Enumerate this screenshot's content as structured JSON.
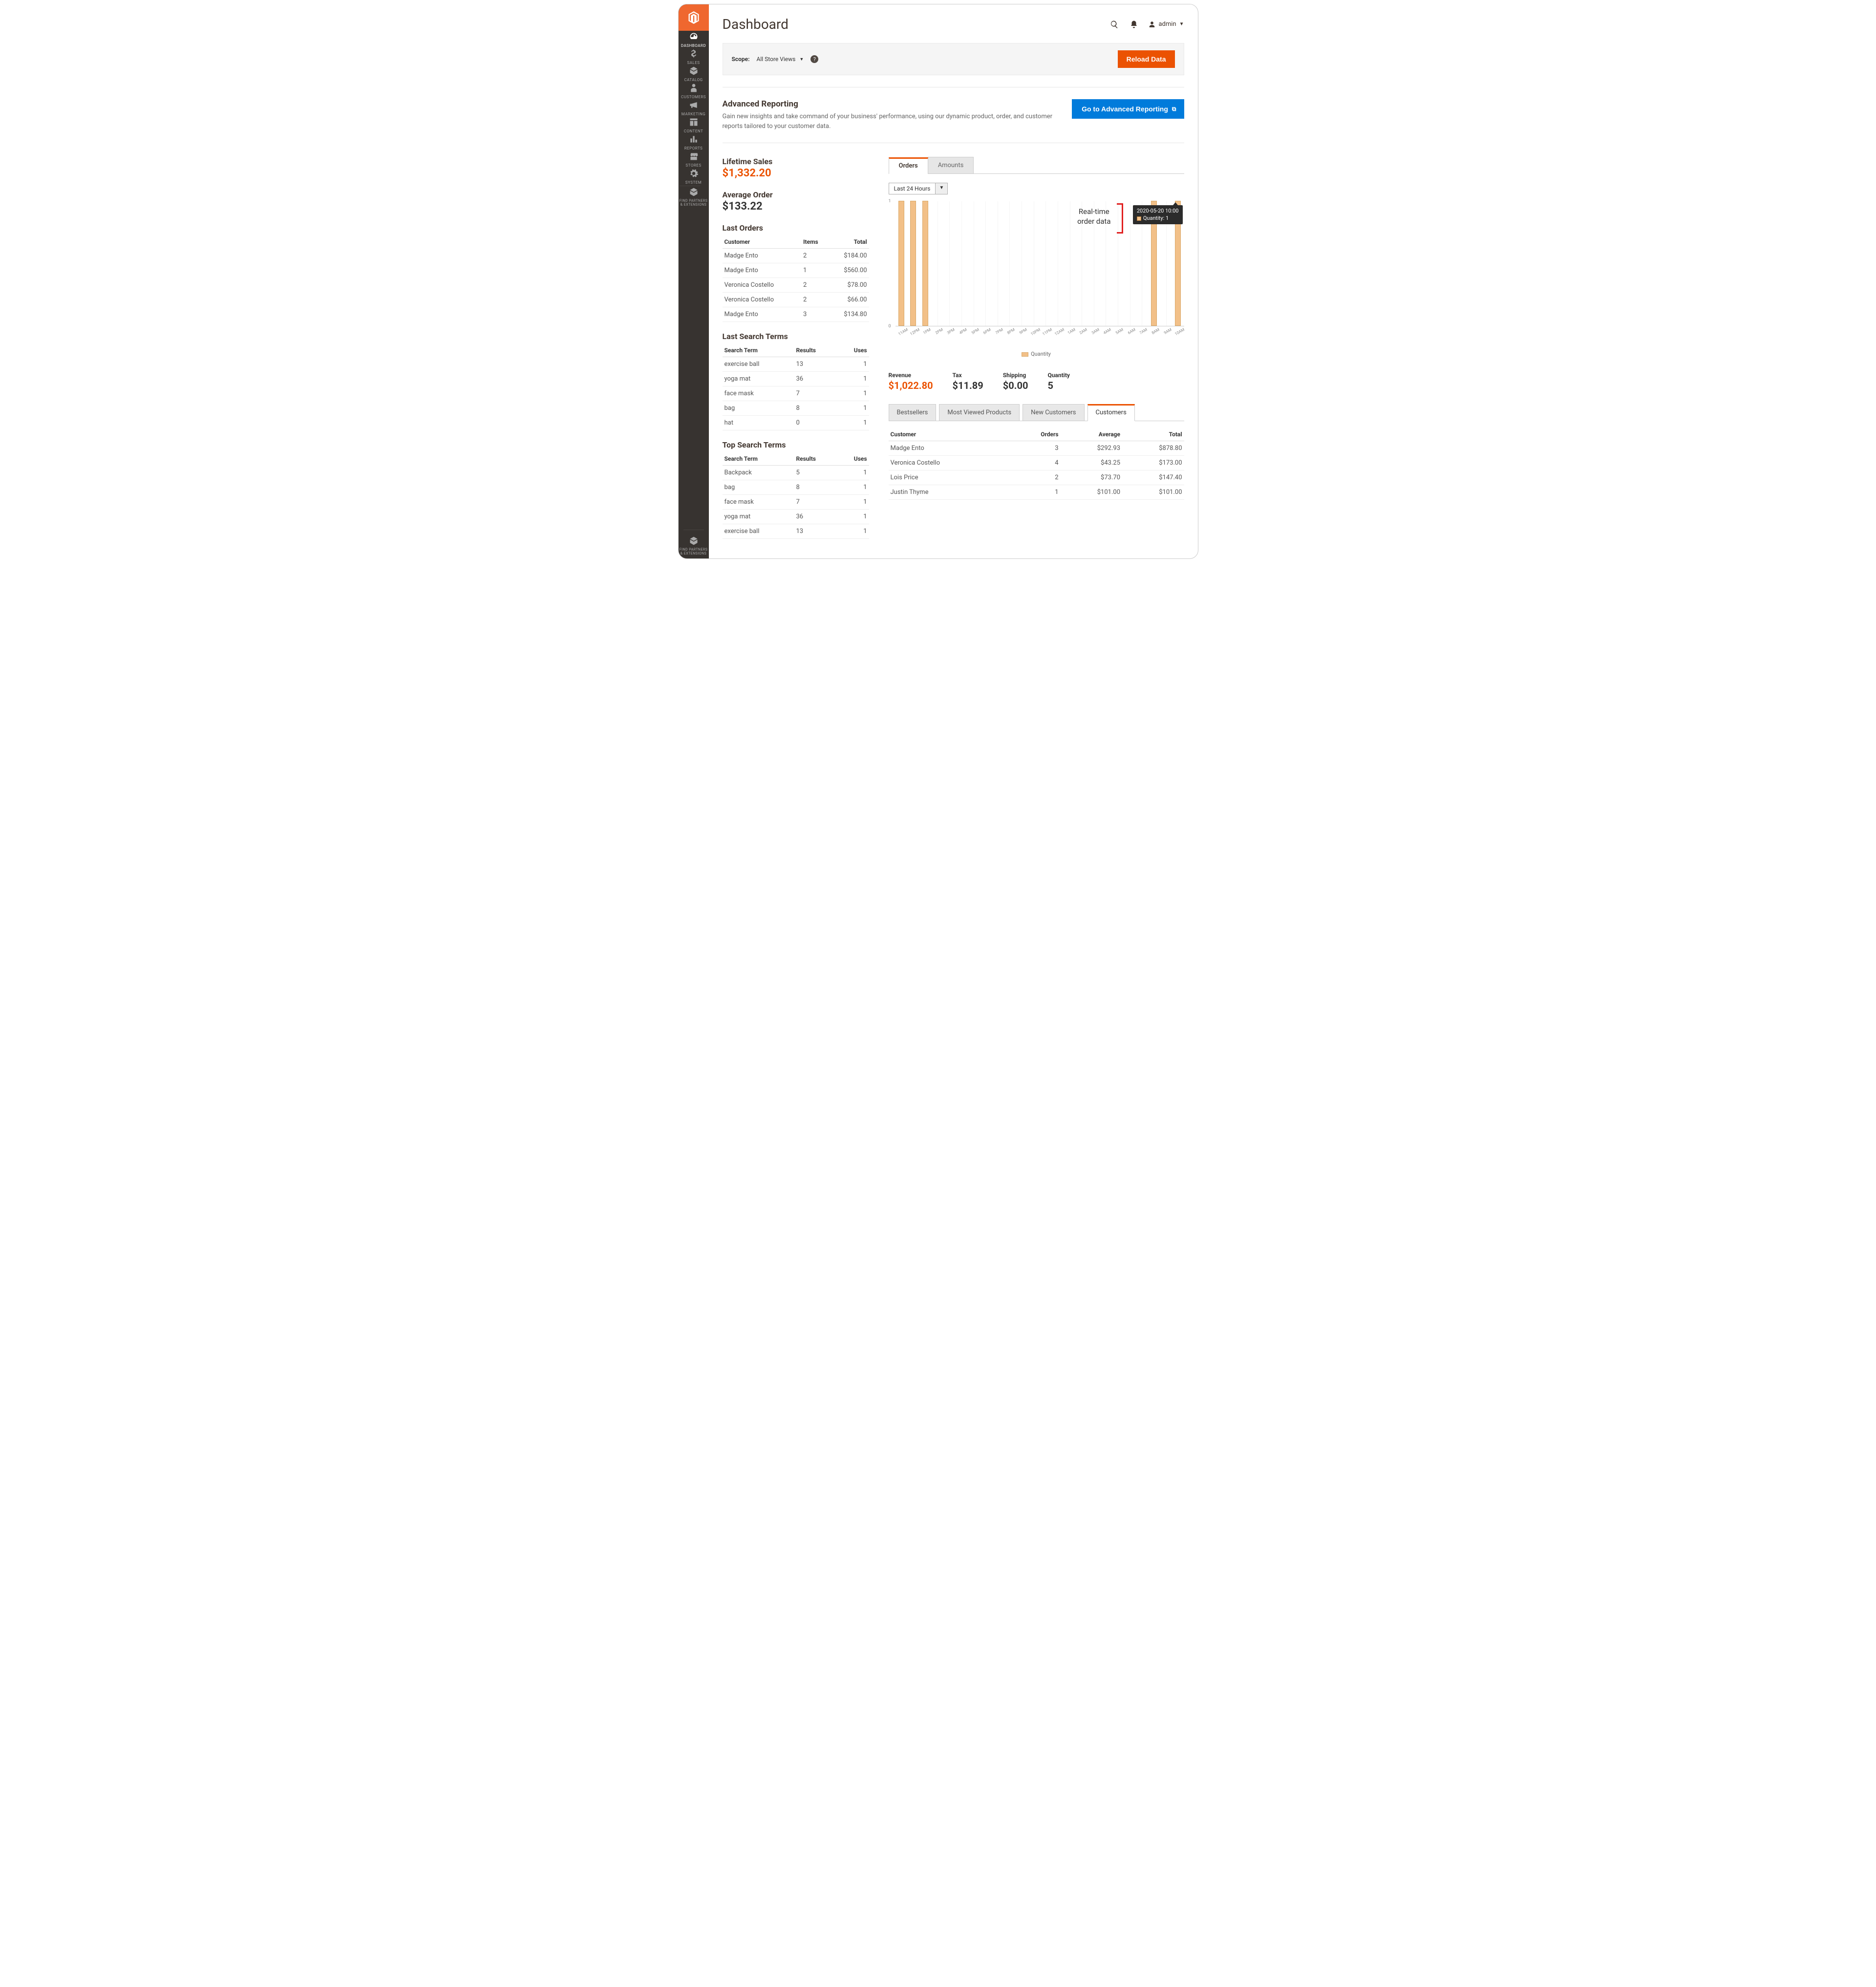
{
  "page_title": "Dashboard",
  "admin_user": "admin",
  "sidebar": {
    "items": [
      {
        "label": "DASHBOARD",
        "icon": "gauge",
        "active": true
      },
      {
        "label": "SALES",
        "icon": "dollar"
      },
      {
        "label": "CATALOG",
        "icon": "cube"
      },
      {
        "label": "CUSTOMERS",
        "icon": "person"
      },
      {
        "label": "MARKETING",
        "icon": "megaphone"
      },
      {
        "label": "CONTENT",
        "icon": "layout"
      },
      {
        "label": "REPORTS",
        "icon": "barchart"
      },
      {
        "label": "STORES",
        "icon": "storefront"
      },
      {
        "label": "SYSTEM",
        "icon": "gear"
      },
      {
        "label": "FIND PARTNERS\n& EXTENSIONS",
        "icon": "cube"
      }
    ],
    "bottom": {
      "label": "FIND PARTNERS\n& EXTENSIONS",
      "icon": "cube"
    }
  },
  "scope": {
    "label": "Scope:",
    "value": "All Store Views",
    "reload_btn": "Reload Data"
  },
  "adv_reporting": {
    "heading": "Advanced Reporting",
    "desc": "Gain new insights and take command of your business' performance, using our dynamic product, order, and customer reports tailored to your customer data.",
    "button": "Go to Advanced Reporting"
  },
  "lifetime_sales": {
    "label": "Lifetime Sales",
    "value": "$1,332.20"
  },
  "average_order": {
    "label": "Average Order",
    "value": "$133.22"
  },
  "last_orders": {
    "heading": "Last Orders",
    "headers": [
      "Customer",
      "Items",
      "Total"
    ],
    "rows": [
      {
        "c": "Madge Ento",
        "i": "2",
        "t": "$184.00"
      },
      {
        "c": "Madge Ento",
        "i": "1",
        "t": "$560.00"
      },
      {
        "c": "Veronica Costello",
        "i": "2",
        "t": "$78.00"
      },
      {
        "c": "Veronica Costello",
        "i": "2",
        "t": "$66.00"
      },
      {
        "c": "Madge Ento",
        "i": "3",
        "t": "$134.80"
      }
    ]
  },
  "last_search": {
    "heading": "Last Search Terms",
    "headers": [
      "Search Term",
      "Results",
      "Uses"
    ],
    "rows": [
      {
        "t": "exercise ball",
        "r": "13",
        "u": "1"
      },
      {
        "t": "yoga mat",
        "r": "36",
        "u": "1"
      },
      {
        "t": "face mask",
        "r": "7",
        "u": "1"
      },
      {
        "t": "bag",
        "r": "8",
        "u": "1"
      },
      {
        "t": "hat",
        "r": "0",
        "u": "1"
      }
    ]
  },
  "top_search": {
    "heading": "Top Search Terms",
    "headers": [
      "Search Term",
      "Results",
      "Uses"
    ],
    "rows": [
      {
        "t": "Backpack",
        "r": "5",
        "u": "1"
      },
      {
        "t": "bag",
        "r": "8",
        "u": "1"
      },
      {
        "t": "face mask",
        "r": "7",
        "u": "1"
      },
      {
        "t": "yoga mat",
        "r": "36",
        "u": "1"
      },
      {
        "t": "exercise ball",
        "r": "13",
        "u": "1"
      }
    ]
  },
  "chart_tabs": {
    "orders": "Orders",
    "amounts": "Amounts"
  },
  "period": "Last 24 Hours",
  "chart_data": {
    "type": "bar",
    "title": "",
    "xlabel": "",
    "ylabel": "",
    "ylim": [
      0,
      1
    ],
    "categories": [
      "11AM",
      "12PM",
      "1PM",
      "2PM",
      "3PM",
      "4PM",
      "5PM",
      "6PM",
      "7PM",
      "8PM",
      "9PM",
      "10PM",
      "11PM",
      "12AM",
      "1AM",
      "2AM",
      "3AM",
      "4AM",
      "5AM",
      "6AM",
      "7AM",
      "8AM",
      "9AM",
      "10AM"
    ],
    "values": [
      1,
      1,
      1,
      0,
      0,
      0,
      0,
      0,
      0,
      0,
      0,
      0,
      0,
      0,
      0,
      0,
      0,
      0,
      0,
      0,
      0,
      1,
      0,
      1
    ],
    "series_name": "Quantity"
  },
  "chart_tooltip": {
    "ts": "2020-05-20 10:00",
    "label": "Quantity: 1"
  },
  "annotation_text": "Real-time\norder data",
  "summary": [
    {
      "label": "Revenue",
      "value": "$1,022.80",
      "accent": true
    },
    {
      "label": "Tax",
      "value": "$11.89"
    },
    {
      "label": "Shipping",
      "value": "$0.00"
    },
    {
      "label": "Quantity",
      "value": "5"
    }
  ],
  "lower_tabs": [
    "Bestsellers",
    "Most Viewed Products",
    "New Customers",
    "Customers"
  ],
  "lower_active_idx": 3,
  "customers_table": {
    "headers": [
      "Customer",
      "Orders",
      "Average",
      "Total"
    ],
    "rows": [
      {
        "c": "Madge Ento",
        "o": "3",
        "a": "$292.93",
        "t": "$878.80"
      },
      {
        "c": "Veronica Costello",
        "o": "4",
        "a": "$43.25",
        "t": "$173.00"
      },
      {
        "c": "Lois Price",
        "o": "2",
        "a": "$73.70",
        "t": "$147.40"
      },
      {
        "c": "Justin Thyme",
        "o": "1",
        "a": "$101.00",
        "t": "$101.00"
      }
    ]
  },
  "legend_label": "Quantity"
}
